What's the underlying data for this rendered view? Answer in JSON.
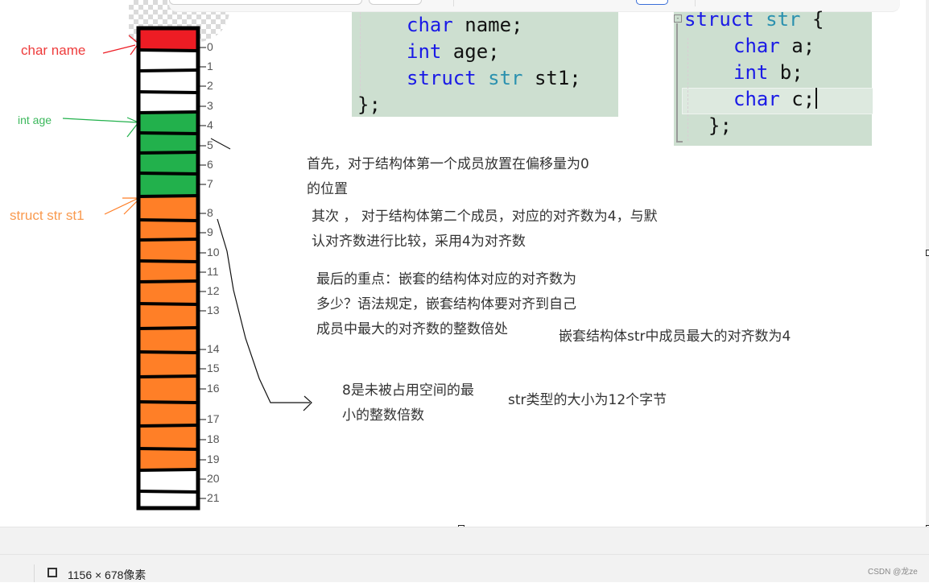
{
  "code_outer": {
    "lines": [
      {
        "kw": "char",
        "ty": "",
        "rest": " name;"
      },
      {
        "kw": "int",
        "ty": "",
        "rest": " age;"
      },
      {
        "kw": "struct",
        "ty": " str",
        "rest": " st1;"
      },
      {
        "kw": "",
        "ty": "",
        "rest": "};"
      }
    ]
  },
  "code_inner": {
    "lines": [
      {
        "kw": "struct",
        "ty": " str",
        "rest": " {"
      },
      {
        "kw": "char",
        "ty": "",
        "rest": " a;"
      },
      {
        "kw": "int",
        "ty": "",
        "rest": " b;"
      },
      {
        "kw": "char",
        "ty": "",
        "rest": " c;"
      },
      {
        "kw": "",
        "ty": "",
        "rest": "};"
      }
    ],
    "fold_symbol": "-"
  },
  "member_labels": {
    "name": "char name",
    "age": "int age",
    "st1": "struct str st1"
  },
  "colors": {
    "name": "#ed1c24",
    "age": "#22b14c",
    "st1": "#ff7f27",
    "empty": "#ffffff",
    "name_label": "#ee3b3b",
    "age_label": "#3cb85c",
    "st1_label": "#f99a4f"
  },
  "memory": {
    "cells": [
      "name",
      "empty",
      "empty",
      "empty",
      "age",
      "age",
      "age",
      "age",
      "st1",
      "st1",
      "st1",
      "st1",
      "st1",
      "st1",
      "st1",
      "st1",
      "st1",
      "st1",
      "st1",
      "st1",
      "empty",
      "empty"
    ],
    "offsets": [
      "0",
      "1",
      "2",
      "3",
      "4",
      "5",
      "6",
      "7",
      "8",
      "9",
      "10",
      "11",
      "12",
      "13",
      "14",
      "15",
      "16",
      "17",
      "18",
      "19",
      "20",
      "21"
    ]
  },
  "notes": {
    "first_line1": "首先，对于结构体第一个成员放置在偏移量为0",
    "first_line2": "的位置",
    "second_line1": "其次 ， 对于结构体第二个成员，对应的对齐数为4，与默",
    "second_line2": "认对齐数进行比较，采用4为对齐数",
    "last_line1": "最后的重点：嵌套的结构体对应的对齐数为",
    "last_line2": "多少？语法规定，嵌套结构体要对齐到自己",
    "last_line3": "成员中最大的对齐数的整数倍处",
    "max_align": "嵌套结构体str中成员最大的对齐数为4",
    "eight_line1": "8是未被占用空间的最",
    "eight_line2": "小的整数倍数",
    "size": "str类型的大小为12个字节"
  },
  "status": {
    "dimensions": "1156 × 678像素",
    "watermark": "CSDN @龙ze"
  }
}
